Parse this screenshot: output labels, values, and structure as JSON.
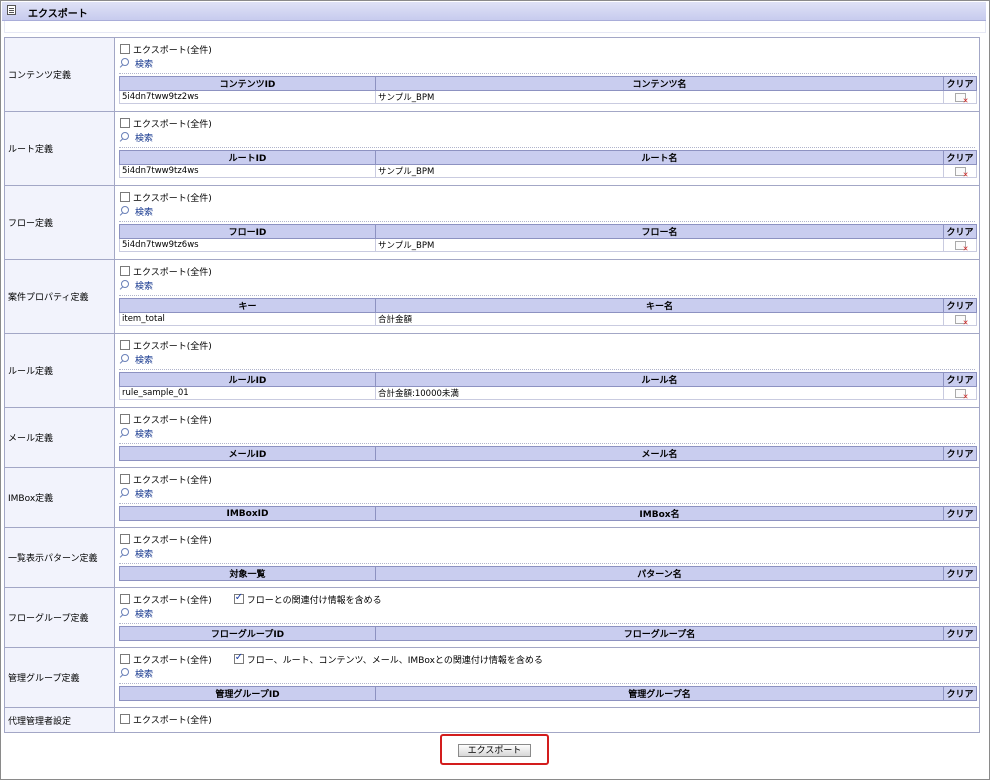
{
  "window": {
    "title": "エクスポート"
  },
  "common": {
    "export_all": "エクスポート(全件)",
    "search": "検索"
  },
  "sections": [
    {
      "label": "コンテンツ定義",
      "headers": [
        "コンテンツID",
        "コンテンツ名",
        "クリア"
      ],
      "rows": [
        [
          "5i4dn7tww9tz2ws",
          "サンプル_BPM"
        ]
      ]
    },
    {
      "label": "ルート定義",
      "headers": [
        "ルートID",
        "ルート名",
        "クリア"
      ],
      "rows": [
        [
          "5i4dn7tww9tz4ws",
          "サンプル_BPM"
        ]
      ]
    },
    {
      "label": "フロー定義",
      "headers": [
        "フローID",
        "フロー名",
        "クリア"
      ],
      "rows": [
        [
          "5i4dn7tww9tz6ws",
          "サンプル_BPM"
        ]
      ]
    },
    {
      "label": "案件プロパティ定義",
      "headers": [
        "キー",
        "キー名",
        "クリア"
      ],
      "rows": [
        [
          "item_total",
          "合計金額"
        ]
      ]
    },
    {
      "label": "ルール定義",
      "headers": [
        "ルールID",
        "ルール名",
        "クリア"
      ],
      "rows": [
        [
          "rule_sample_01",
          "合計金額:10000未満"
        ]
      ]
    },
    {
      "label": "メール定義",
      "headers": [
        "メールID",
        "メール名",
        "クリア"
      ],
      "rows": []
    },
    {
      "label": "IMBox定義",
      "headers": [
        "IMBoxID",
        "IMBox名",
        "クリア"
      ],
      "rows": []
    },
    {
      "label": "一覧表示パターン定義",
      "headers": [
        "対象一覧",
        "パターン名",
        "クリア"
      ],
      "rows": []
    },
    {
      "label": "フローグループ定義",
      "extra_option": "フローとの関連付け情報を含める",
      "headers": [
        "フローグループID",
        "フローグループ名",
        "クリア"
      ],
      "rows": []
    },
    {
      "label": "管理グループ定義",
      "extra_option": "フロー、ルート、コンテンツ、メール、IMBoxとの関連付け情報を含める",
      "headers": [
        "管理グループID",
        "管理グループ名",
        "クリア"
      ],
      "rows": []
    }
  ],
  "admin": {
    "label": "代理管理者設定"
  },
  "export_button": "エクスポート",
  "colors": {
    "header_bg": "#c9cdef",
    "label_bg": "#f2f3fc",
    "highlight": "#d31d1d"
  }
}
